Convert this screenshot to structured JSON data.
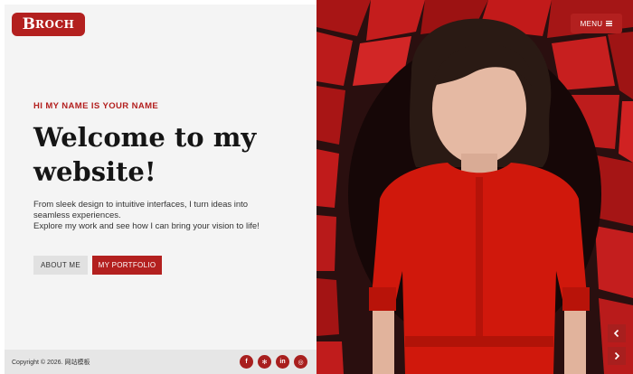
{
  "brand": {
    "logo_first": "B",
    "logo_rest": "ROCH",
    "accent_color": "#b3201f"
  },
  "hero": {
    "eyebrow": "HI MY NAME IS YOUR NAME",
    "headline_line1": "Welcome to my",
    "headline_line2": "website!",
    "description_line1": "From sleek design to intuitive interfaces, I turn ideas into",
    "description_line2": "seamless experiences.",
    "description_line3": "Explore my work and see how I can bring your vision to life!"
  },
  "buttons": {
    "about": "ABOUT ME",
    "portfolio": "MY PORTFOLIO"
  },
  "footer": {
    "copyright": "Copyright © 2026. 网站模板",
    "socials": [
      {
        "icon": "facebook-icon",
        "glyph": "f"
      },
      {
        "icon": "yelp-icon",
        "glyph": "✻"
      },
      {
        "icon": "linkedin-icon",
        "glyph": "in"
      },
      {
        "icon": "instagram-icon",
        "glyph": "◎"
      }
    ]
  },
  "menu": {
    "label": "MENU"
  },
  "slider": {
    "prev_icon": "chevron-left-icon",
    "next_icon": "chevron-right-icon"
  },
  "hero_image": {
    "subject": "woman-in-red-dress-broken-red-tiles",
    "dress_color": "#d0180c",
    "tile_color": "#b31414"
  }
}
